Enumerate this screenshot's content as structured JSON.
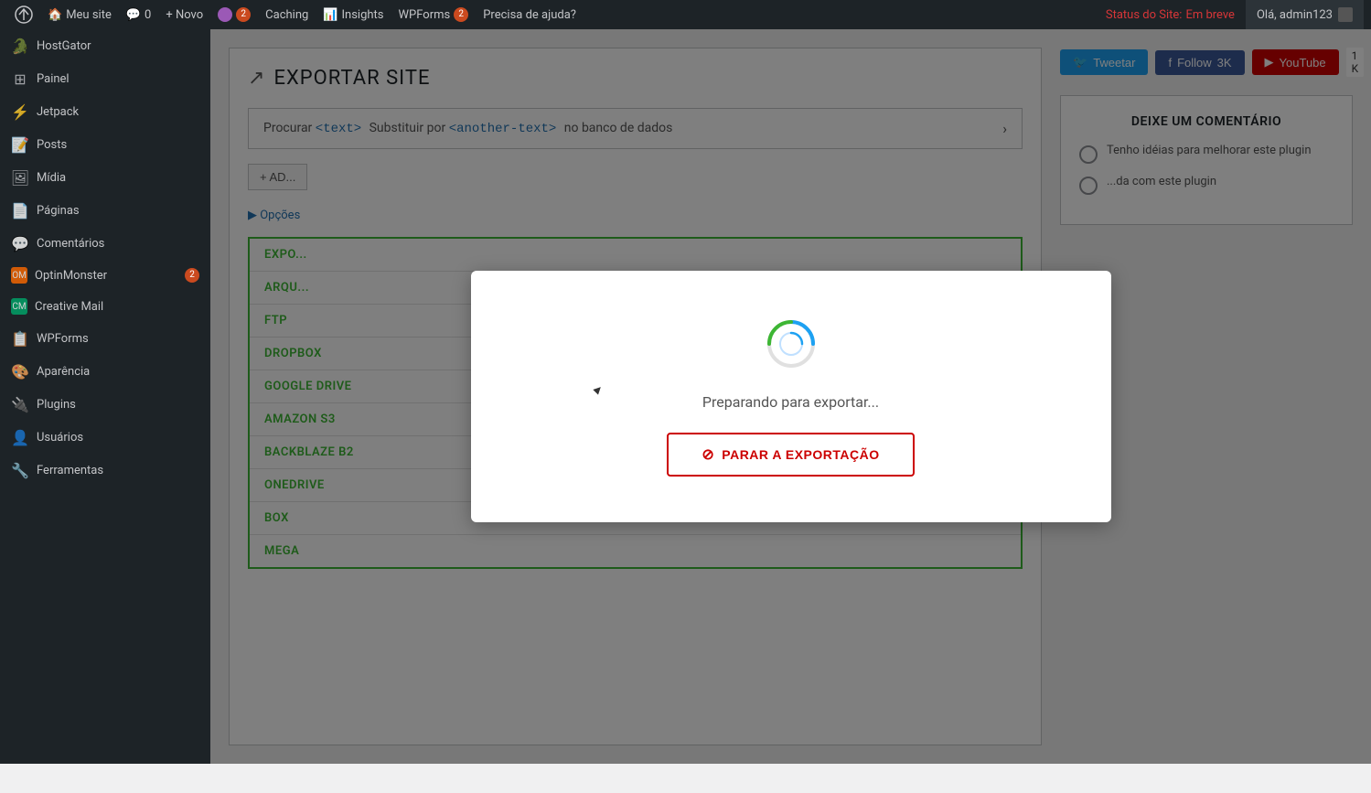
{
  "adminBar": {
    "wpLogoLabel": "WordPress",
    "meuSite": "Meu site",
    "comments": "0",
    "novo": "+ Novo",
    "yoast": "",
    "yoastBadge": "2",
    "caching": "Caching",
    "insights": "Insights",
    "wpforms": "WPForms",
    "wpformsBadge": "2",
    "ajuda": "Precisa de ajuda?",
    "statusLabel": "Status do Site:",
    "statusValue": "Em breve",
    "howdy": "Olá, admin123"
  },
  "sidebar": {
    "items": [
      {
        "id": "hostgator",
        "icon": "🐊",
        "label": "HostGator"
      },
      {
        "id": "painel",
        "icon": "⊞",
        "label": "Painel"
      },
      {
        "id": "jetpack",
        "icon": "⚡",
        "label": "Jetpack"
      },
      {
        "id": "posts",
        "icon": "📝",
        "label": "Posts"
      },
      {
        "id": "midia",
        "icon": "🖼",
        "label": "Mídia"
      },
      {
        "id": "paginas",
        "icon": "📄",
        "label": "Páginas"
      },
      {
        "id": "comentarios",
        "icon": "💬",
        "label": "Comentários"
      },
      {
        "id": "optinmonster",
        "icon": "👾",
        "label": "OptinMonster",
        "badge": "2"
      },
      {
        "id": "creativemail",
        "icon": "✉",
        "label": "Creative Mail"
      },
      {
        "id": "wpforms",
        "icon": "📋",
        "label": "WPForms"
      },
      {
        "id": "aparencia",
        "icon": "🎨",
        "label": "Aparência"
      },
      {
        "id": "plugins",
        "icon": "🔌",
        "label": "Plugins"
      },
      {
        "id": "usuarios",
        "icon": "👤",
        "label": "Usuários"
      },
      {
        "id": "ferramentas",
        "icon": "🔧",
        "label": "Ferramentas"
      }
    ]
  },
  "main": {
    "pageTitle": "EXPORTAR SITE",
    "searchReplace": {
      "procurar": "Procurar",
      "textTag": "<text>",
      "substituirPor": "Substituir por",
      "anotherTextTag": "<another-text>",
      "noBancoDeDados": "no banco de dados"
    },
    "addButton": "+ AD...",
    "optionsLabel": "▶ Opções",
    "exportList": [
      "EXPO...",
      "ARQU...",
      "FTP",
      "DROPBOX",
      "GOOGLE DRIVE",
      "AMAZON S3",
      "BACKBLAZE B2",
      "ONEDRIVE",
      "BOX",
      "MEGA"
    ]
  },
  "rightPanel": {
    "tweetar": "Tweetar",
    "follow": "Follow",
    "followCount": "3K",
    "youtube": "YouTube",
    "youtubeCount": "1 K",
    "commentSection": {
      "title": "DEIXE UM COMENTÁRIO",
      "option1": "Tenho idéias para melhorar este plugin",
      "option2": "...da com este plugin"
    }
  },
  "modal": {
    "loadingText": "Preparando para exportar...",
    "stopButton": "⊘ PARAR A EXPORTAÇÃO"
  }
}
